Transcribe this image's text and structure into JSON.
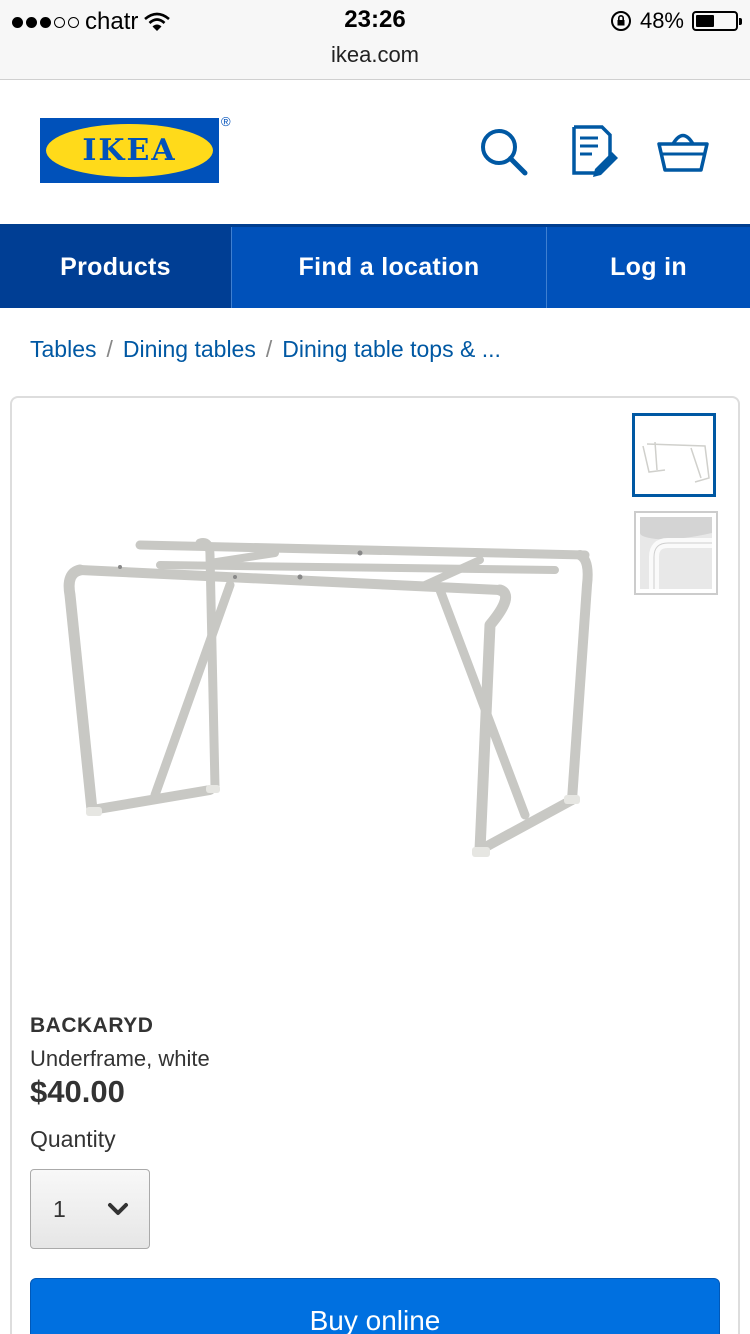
{
  "status_bar": {
    "carrier": "chatr",
    "time": "23:26",
    "url": "ikea.com",
    "battery": "48%",
    "battery_level": 0.48,
    "signal_bars": 3
  },
  "header": {
    "logo_text": "IKEA",
    "registered_mark": "®",
    "icons": [
      "search-icon",
      "shopping-list-icon",
      "basket-icon"
    ]
  },
  "nav": {
    "items": [
      {
        "label": "Products"
      },
      {
        "label": "Find a location"
      },
      {
        "label": "Log in"
      }
    ]
  },
  "breadcrumb": [
    "Tables",
    "Dining tables",
    "Dining table tops & ..."
  ],
  "product": {
    "name": "BACKARYD",
    "description": "Underframe, white",
    "price": "$40.00",
    "quantity_label": "Quantity",
    "quantity_value": "1",
    "buy_label": "Buy online"
  },
  "colors": {
    "brand_blue": "#0051ba",
    "brand_yellow": "#ffda1a",
    "link_blue": "#0058a3",
    "button_blue": "#0070e0"
  }
}
